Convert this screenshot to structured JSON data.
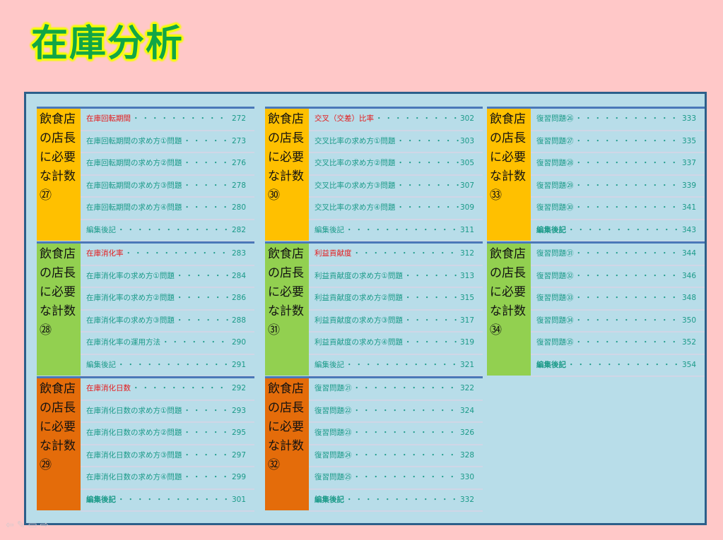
{
  "title": "在庫分析",
  "blocks": [
    {
      "label": "飲食店の店長に必要な計数㉗",
      "color": "orange",
      "rows": [
        {
          "text": "在庫回転期間",
          "page": "272",
          "style": "red"
        },
        {
          "text": "在庫回転期間の求め方①問題",
          "page": "273"
        },
        {
          "text": "在庫回転期間の求め方②問題",
          "page": "276"
        },
        {
          "text": "在庫回転期間の求め方③問題",
          "page": "278"
        },
        {
          "text": "在庫回転期間の求め方④問題",
          "page": "280"
        },
        {
          "text": "編集後記",
          "page": "282"
        }
      ]
    },
    {
      "label": "飲食店の店長に必要な計数㉘",
      "color": "green",
      "rows": [
        {
          "text": "在庫消化率",
          "page": "283",
          "style": "red"
        },
        {
          "text": "在庫消化率の求め方①問題",
          "page": "284"
        },
        {
          "text": "在庫消化率の求め方②問題",
          "page": "286"
        },
        {
          "text": "在庫消化率の求め方③問題",
          "page": "288"
        },
        {
          "text": "在庫消化率の運用方法",
          "page": "290"
        },
        {
          "text": "編集後記",
          "page": "291"
        }
      ]
    },
    {
      "label": "飲食店の店長に必要な計数㉙",
      "color": "dark",
      "rows": [
        {
          "text": "在庫消化日数",
          "page": "292",
          "style": "red"
        },
        {
          "text": "在庫消化日数の求め方①問題",
          "page": "293"
        },
        {
          "text": "在庫消化日数の求め方②問題",
          "page": "295"
        },
        {
          "text": "在庫消化日数の求め方③問題",
          "page": "297"
        },
        {
          "text": "在庫消化日数の求め方④問題",
          "page": "299"
        },
        {
          "text": "編集後記",
          "page": "301",
          "style": "bold"
        }
      ]
    },
    {
      "label": "飲食店の店長に必要な計数㉚",
      "color": "orange",
      "rows": [
        {
          "text": "交叉（交差）比率",
          "page": "302",
          "style": "red"
        },
        {
          "text": "交叉比率の求め方①問題",
          "page": "303"
        },
        {
          "text": "交叉比率の求め方②問題",
          "page": "305"
        },
        {
          "text": "交叉比率の求め方③問題",
          "page": "307"
        },
        {
          "text": "交叉比率の求め方④問題",
          "page": "309"
        },
        {
          "text": "編集後記",
          "page": "311"
        }
      ]
    },
    {
      "label": "飲食店の店長に必要な計数㉛",
      "color": "green",
      "rows": [
        {
          "text": "利益貢献度",
          "page": "312",
          "style": "red"
        },
        {
          "text": "利益貢献度の求め方①問題",
          "page": "313"
        },
        {
          "text": "利益貢献度の求め方②問題",
          "page": "315"
        },
        {
          "text": "利益貢献度の求め方③問題",
          "page": "317"
        },
        {
          "text": "利益貢献度の求め方④問題",
          "page": "319"
        },
        {
          "text": "編集後記",
          "page": "321"
        }
      ]
    },
    {
      "label": "飲食店の店長に必要な計数㉜",
      "color": "dark",
      "rows": [
        {
          "text": "復習問題㉑",
          "page": "322"
        },
        {
          "text": "復習問題㉒",
          "page": "324"
        },
        {
          "text": "復習問題㉓",
          "page": "326"
        },
        {
          "text": "復習問題㉔",
          "page": "328"
        },
        {
          "text": "復習問題㉕",
          "page": "330"
        },
        {
          "text": "編集後記",
          "page": "332",
          "style": "bold"
        }
      ]
    },
    {
      "label": "飲食店の店長に必要な計数㉝",
      "color": "orange",
      "rows": [
        {
          "text": "復習問題㉖",
          "page": "333"
        },
        {
          "text": "復習問題㉗",
          "page": "335"
        },
        {
          "text": "復習問題㉘",
          "page": "337"
        },
        {
          "text": "復習問題㉙",
          "page": "339"
        },
        {
          "text": "復習問題㉚",
          "page": "341"
        },
        {
          "text": "編集後記",
          "page": "343",
          "style": "bold"
        }
      ]
    },
    {
      "label": "飲食店の店長に必要な計数㉞",
      "color": "green",
      "rows": [
        {
          "text": "復習問題㉛",
          "page": "344"
        },
        {
          "text": "復習問題㉜",
          "page": "346"
        },
        {
          "text": "復習問題㉝",
          "page": "348"
        },
        {
          "text": "復習問題㉞",
          "page": "350"
        },
        {
          "text": "復習問題㉟",
          "page": "352"
        },
        {
          "text": "編集後記",
          "page": "354",
          "style": "bold"
        }
      ]
    }
  ],
  "nav": [
    "back-arrow-icon",
    "pen-icon",
    "menu-icon",
    "forward-arrow-icon"
  ],
  "colors": {
    "orange": "#ffc000",
    "green": "#92d050",
    "dark": "#e46c0a",
    "panel": "#b8dde9",
    "background": "#ffc8c8"
  }
}
